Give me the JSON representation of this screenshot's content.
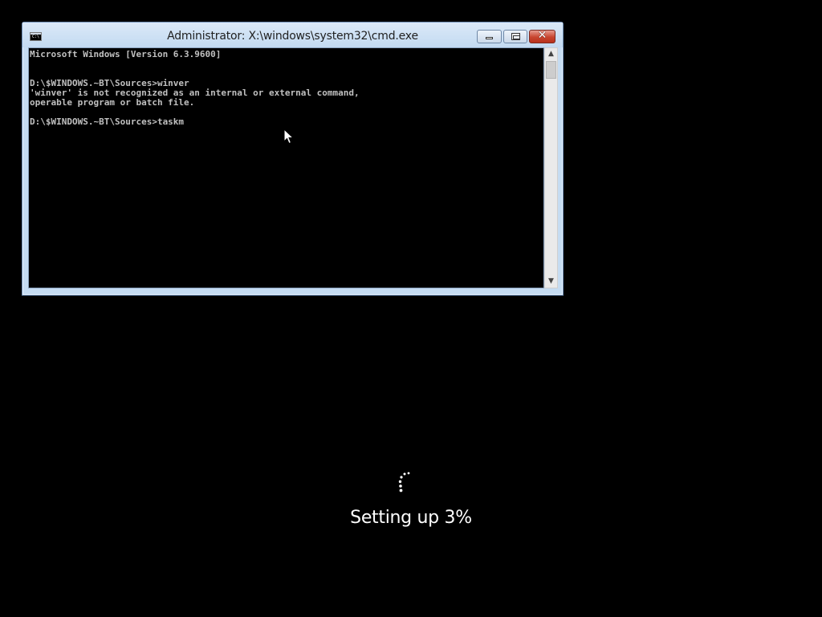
{
  "window": {
    "title": "Administrator: X:\\windows\\system32\\cmd.exe",
    "icon": "cmd-icon",
    "buttons": {
      "minimize_icon": "minimize-icon",
      "maximize_icon": "maximize-icon",
      "close_icon": "close-icon",
      "close_glyph": "✕"
    }
  },
  "console": {
    "lines": [
      "Microsoft Windows [Version 6.3.9600]",
      "",
      "",
      "D:\\$WINDOWS.~BT\\Sources>winver",
      "'winver' is not recognized as an internal or external command,",
      "operable program or batch file.",
      "",
      "D:\\$WINDOWS.~BT\\Sources>taskm"
    ],
    "text_color": "#c0c0c0",
    "background": "#000000"
  },
  "scrollbar": {
    "up_glyph": "▲",
    "down_glyph": "▼"
  },
  "setup": {
    "status_text": "Setting up 3%",
    "progress_percent": 3
  },
  "colors": {
    "desktop_background": "#000000",
    "window_frame": "#c5dcf2",
    "close_button": "#c8452f"
  }
}
